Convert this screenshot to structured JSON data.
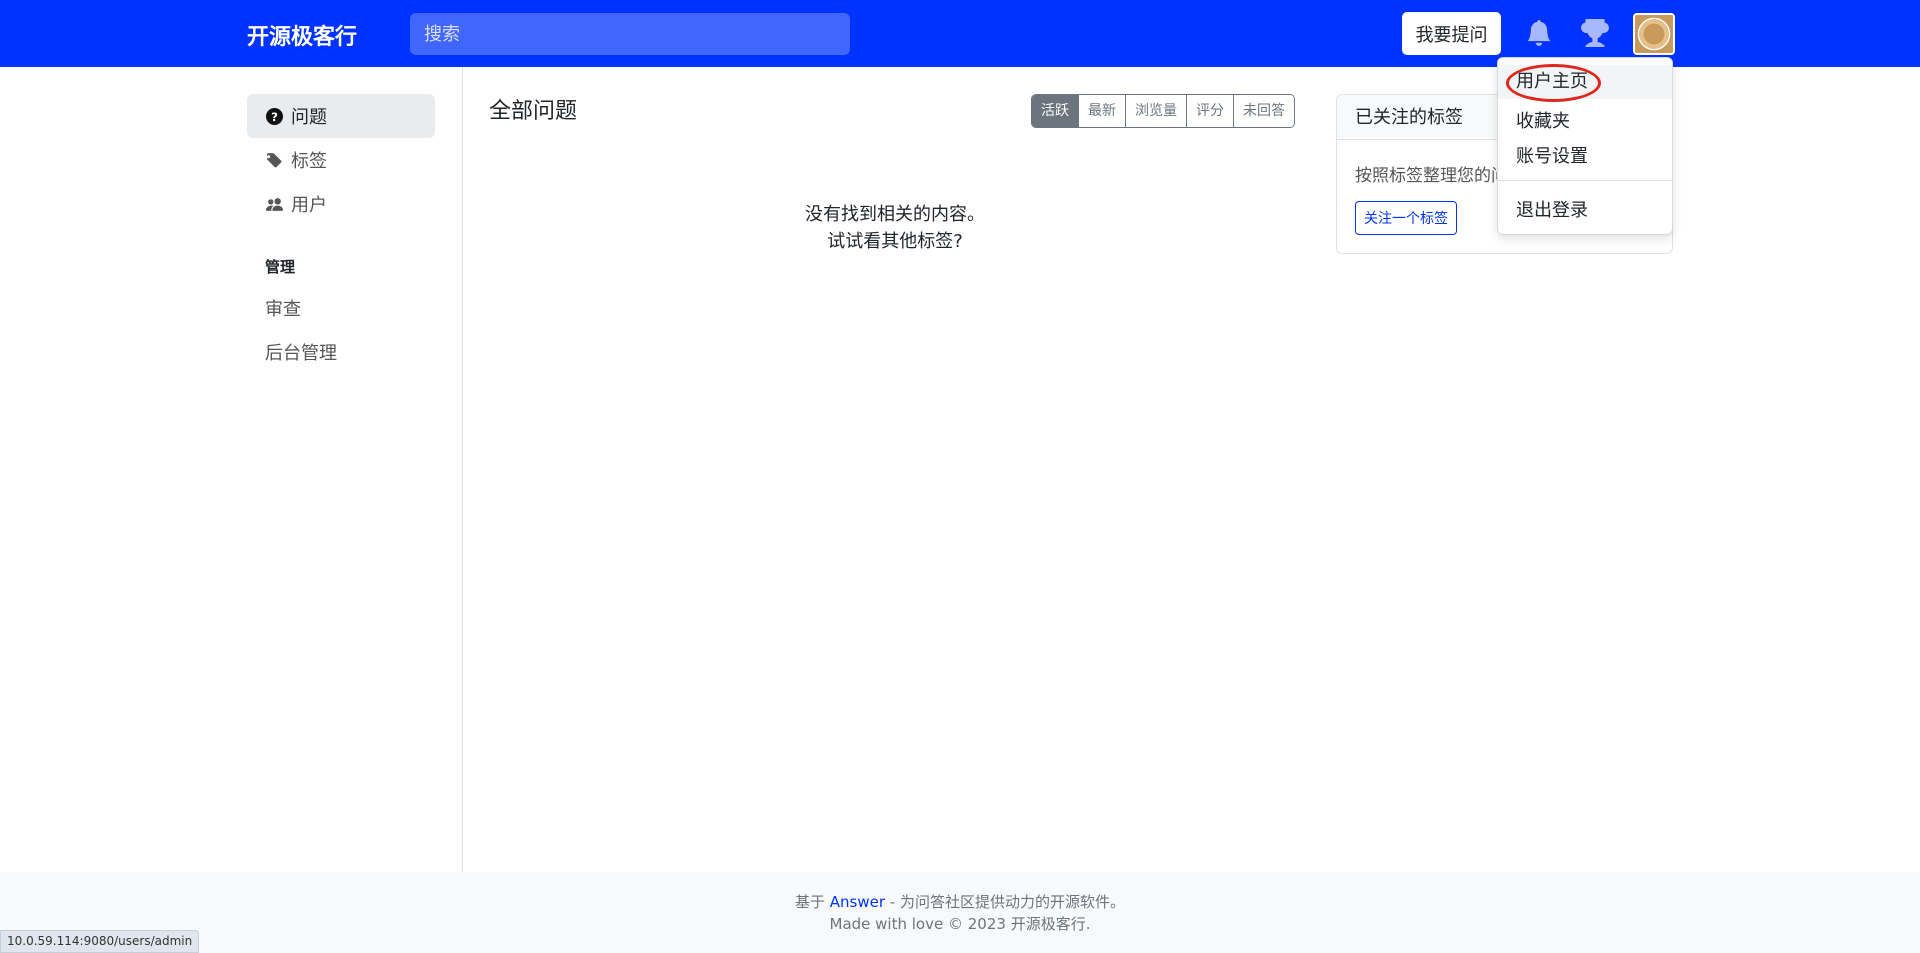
{
  "header": {
    "brand": "开源极客行",
    "search_placeholder": "搜索",
    "ask_button": "我要提问",
    "icons": [
      "bell-icon",
      "trophy-icon"
    ],
    "brand_color": "#0033ff"
  },
  "sidebar": {
    "items": [
      {
        "label": "问题",
        "icon": "question-circle-icon",
        "active": true
      },
      {
        "label": "标签",
        "icon": "tag-icon",
        "active": false
      },
      {
        "label": "用户",
        "icon": "people-icon",
        "active": false
      }
    ],
    "admin_heading": "管理",
    "admin_items": [
      {
        "label": "审查"
      },
      {
        "label": "后台管理"
      }
    ]
  },
  "main": {
    "title": "全部问题",
    "sort_tabs": [
      {
        "label": "活跃",
        "active": true
      },
      {
        "label": "最新",
        "active": false
      },
      {
        "label": "浏览量",
        "active": false
      },
      {
        "label": "评分",
        "active": false
      },
      {
        "label": "未回答",
        "active": false
      }
    ],
    "empty_line1": "没有找到相关的内容。",
    "empty_line2": "试试看其他标签?"
  },
  "followed_tags": {
    "title": "已关注的标签",
    "description": "按照标签整理您的问题",
    "follow_button": "关注一个标签"
  },
  "user_menu": {
    "items": [
      "用户主页",
      "收藏夹",
      "账号设置"
    ],
    "logout": "退出登录",
    "highlight_color": "#e0261c"
  },
  "footer": {
    "prefix": "基于 ",
    "link": "Answer",
    "suffix": " - 为问答社区提供动力的开源软件。",
    "line2": "Made with love © 2023 开源极客行."
  },
  "status_url": "10.0.59.114:9080/users/admin"
}
